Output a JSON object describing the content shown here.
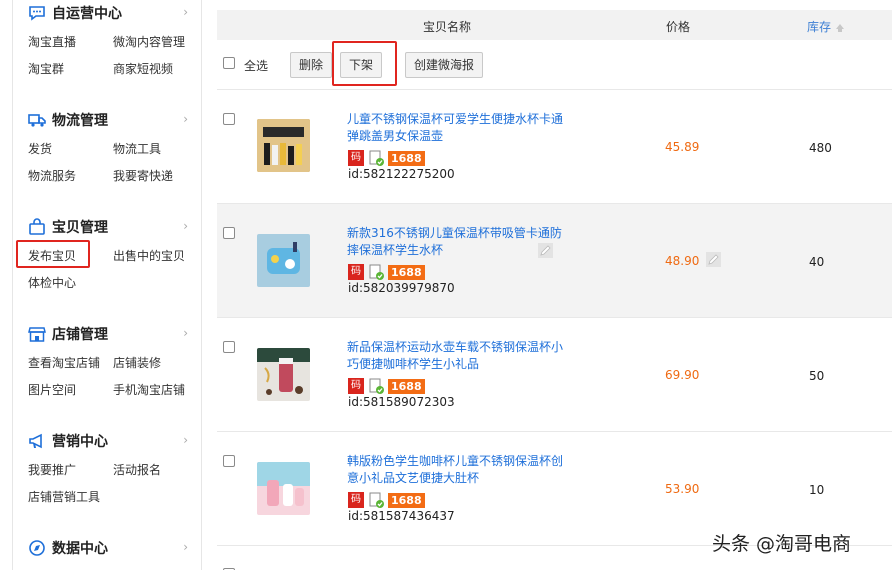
{
  "sidebar": {
    "groups": [
      {
        "title": "自运营中心",
        "icon": "chat-icon",
        "links": [
          "淘宝直播",
          "微淘内容管理",
          "淘宝群",
          "商家短视频"
        ]
      },
      {
        "title": "物流管理",
        "icon": "truck-icon",
        "links": [
          "发货",
          "物流工具",
          "物流服务",
          "我要寄快递"
        ]
      },
      {
        "title": "宝贝管理",
        "icon": "bag-icon",
        "links": [
          "发布宝贝",
          "出售中的宝贝",
          "体检中心"
        ]
      },
      {
        "title": "店铺管理",
        "icon": "store-icon",
        "links": [
          "查看淘宝店铺",
          "店铺装修",
          "图片空间",
          "手机淘宝店铺"
        ]
      },
      {
        "title": "营销中心",
        "icon": "megaphone-icon",
        "links": [
          "我要推广",
          "活动报名",
          "店铺营销工具"
        ]
      },
      {
        "title": "数据中心",
        "icon": "compass-icon",
        "links": []
      }
    ],
    "highlighted_link": "发布宝贝"
  },
  "table": {
    "columns": {
      "name": "宝贝名称",
      "price": "价格",
      "stock": "库存"
    },
    "toolbar": {
      "select_all": "全选",
      "delete": "删除",
      "delist": "下架",
      "create_poster": "创建微海报"
    },
    "badges": {
      "code": "码",
      "supplier": "1688"
    },
    "rows": [
      {
        "title": "儿童不锈钢保温杯可爱学生便捷水杯卡通弹跳盖男女保温壶",
        "id": "id:582122275200",
        "price": "45.89",
        "stock": "480"
      },
      {
        "title": "新款316不锈钢儿童保温杯带吸管卡通防摔保温杯学生水杯",
        "id": "id:582039979870",
        "price": "48.90",
        "stock": "40"
      },
      {
        "title": "新品保温杯运动水壶车载不锈钢保温杯小巧便捷咖啡杯学生小礼品",
        "id": "id:581589072303",
        "price": "69.90",
        "stock": "50"
      },
      {
        "title": "韩版粉色学生咖啡杯儿童不锈钢保温杯创意小礼品文艺便捷大肚杯",
        "id": "id:581587436437",
        "price": "53.90",
        "stock": "10"
      }
    ]
  },
  "watermark": "头条 @淘哥电商",
  "colors": {
    "link_blue": "#1e6fd9",
    "price_orange": "#ef6a12",
    "highlight_red": "#e0251f"
  }
}
